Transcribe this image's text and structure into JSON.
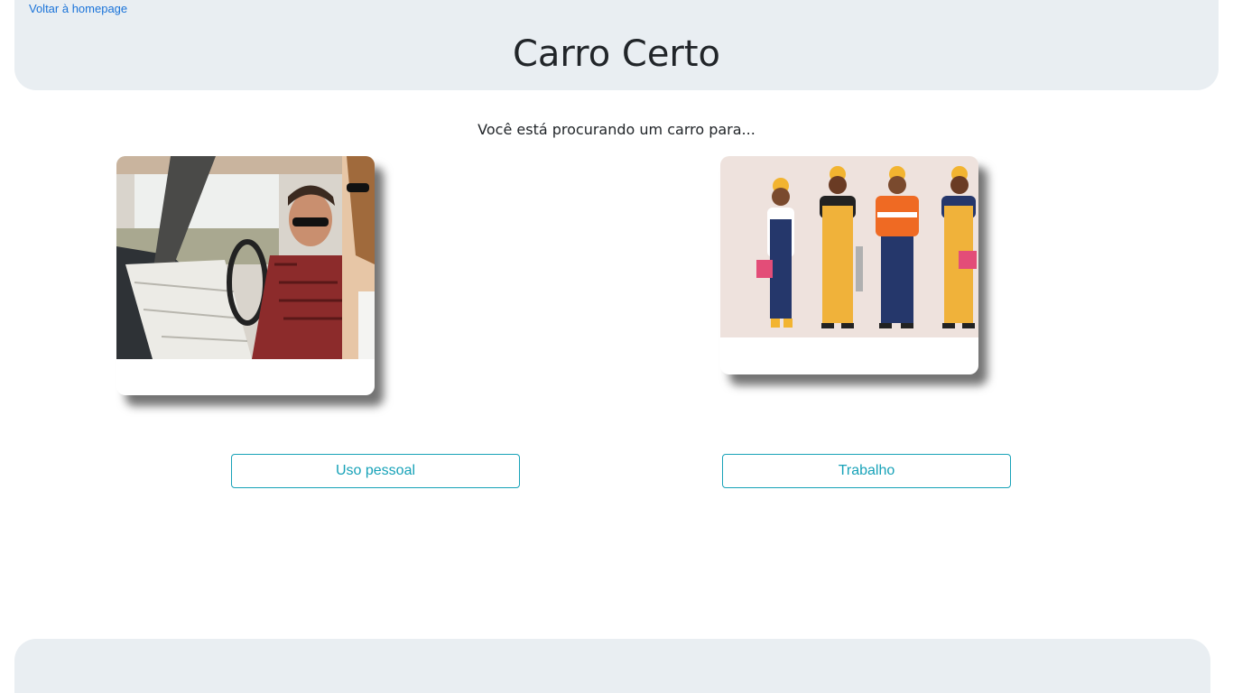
{
  "header": {
    "back_link": "Voltar à homepage",
    "title": "Carro Certo"
  },
  "main": {
    "prompt": "Você está procurando um carro para...",
    "options": [
      {
        "image": "couple-driving-with-map-photo",
        "button_label": "Uso pessoal"
      },
      {
        "image": "workers-illustration",
        "button_label": "Trabalho"
      }
    ]
  },
  "colors": {
    "header_bg": "#e9eef2",
    "link": "#1a73d9",
    "button_accent": "#17a2b8"
  }
}
